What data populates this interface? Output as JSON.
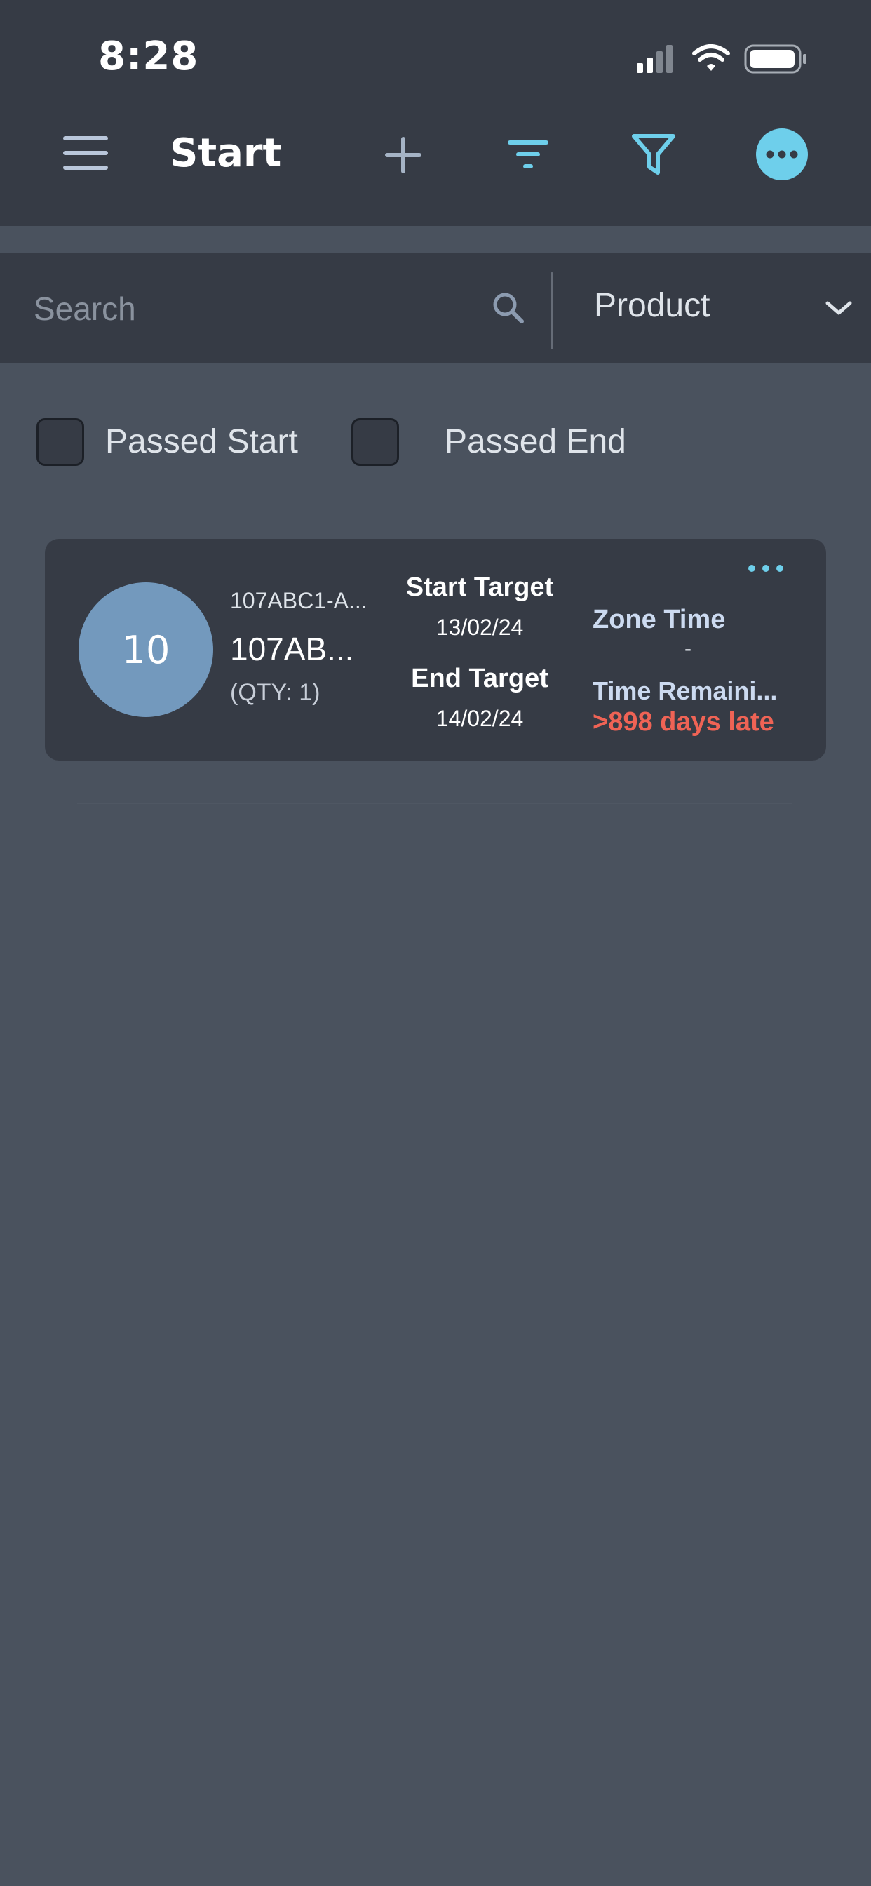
{
  "status_bar": {
    "time": "8:28"
  },
  "header": {
    "title": "Start",
    "icons": {
      "menu": "hamburger-menu-icon",
      "add": "plus-icon",
      "sort": "sort-lines-icon",
      "filter": "funnel-icon",
      "more": "more-dots-icon"
    }
  },
  "search": {
    "placeholder": "Search",
    "value": ""
  },
  "product_dropdown": {
    "selected": "Product"
  },
  "filters": {
    "passed_start_label": "Passed Start",
    "passed_start_checked": false,
    "passed_end_label": "Passed End",
    "passed_end_checked": false
  },
  "items": [
    {
      "count": "10",
      "code": "107ABC1-A...",
      "name": "107AB...",
      "qty": "(QTY: 1)",
      "start_target_label": "Start Target",
      "start_target_value": "13/02/24",
      "end_target_label": "End Target",
      "end_target_value": "14/02/24",
      "zone_time_label": "Zone Time",
      "zone_time_value": "-",
      "time_remaining_label": "Time Remaini...",
      "time_remaining_value": ">898 days late"
    }
  ],
  "colors": {
    "accent": "#6ecfeb",
    "background": "#4a525e",
    "surface": "#363b45",
    "late": "#ef6355",
    "circle": "#7399bd"
  }
}
